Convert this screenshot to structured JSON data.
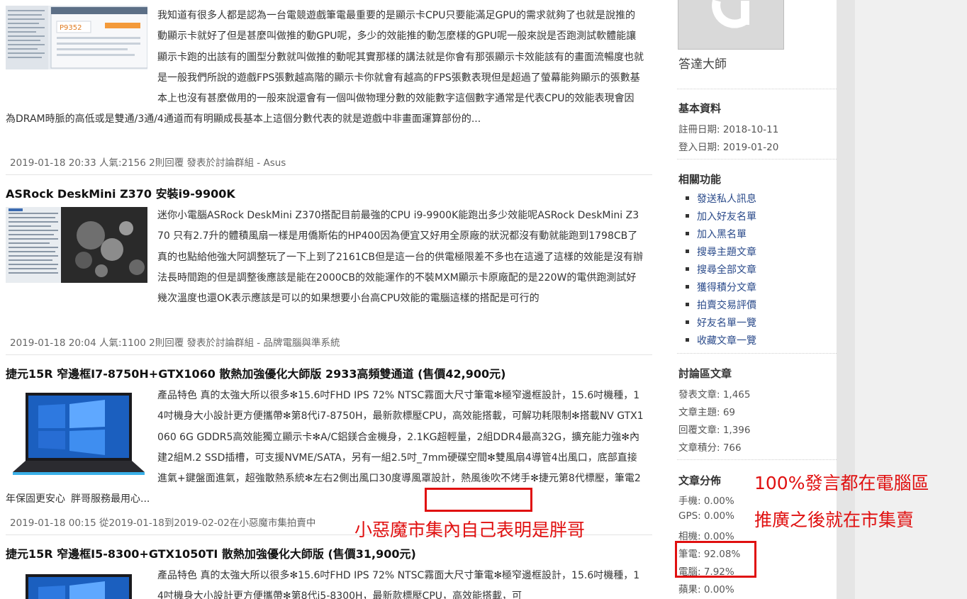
{
  "posts": [
    {
      "title": "",
      "excerpt": "我知道有很多人都是認為一台電競遊戲筆電最重要的是顯示卡CPU只要能滿足GPU的需求就夠了也就是說推的動顯示卡就好了但是甚麼叫做推的動GPU呢，多少的效能推的動怎麼樣的GPU呢一般來說是否跑測試軟體能讓顯示卡跑的出該有的圖型分數就叫做推的動呢其實那樣的講法就是你會有那張顯示卡效能該有的畫面流暢度也就是一般我們所說的遊戲FPS張數越高階的顯示卡你就會有越高的FPS張數表現但是超過了螢幕能夠顯示的張數基本上也沒有甚麼做用的一般來說還會有一個叫做物理分數的效能數字這個數字通常是代表CPU的效能表現會因為DRAM時脈的高低或是雙通/3通/4通道而有明顯成長基本上這個分數代表的就是遊戲中非畫面運算部份的...",
      "meta": "2019-01-18 20:33   人氣:2156   2則回覆   發表於討論群組 - Asus",
      "thumb_text": "P9352"
    },
    {
      "title": "ASRock DeskMini Z370 安裝i9-9900K",
      "excerpt": "迷你小電腦ASRock DeskMini Z370搭配目前最強的CPU i9-9900K能跑出多少效能呢ASRock DeskMini Z370 只有2.7升的體積風扇一樣是用僑斯佑的HP400因為便宜又好用全原廠的狀況都沒有動就能跑到1798CB了真的也點給他強大阿調整玩了一下上到了2161CB但是這一台的供電極限差不多也在這邊了這樣的效能是沒有辦法長時間跑的但是調整後應該是能在2000CB的效能運作的不裝MXM顯示卡原廠配的是220W的電供跑測試好幾次溫度也還OK表示應該是可以的如果想要小台高CPU效能的電腦這樣的搭配是可行的",
      "meta": "2019-01-18 20:04   人氣:1100   2則回覆   發表於討論群組 - 品牌電腦與準系統"
    },
    {
      "title": "捷元15R 窄邊框I7-8750H+GTX1060 散熱加強優化大師版 2933高頻雙通道 (售價42,900元)",
      "excerpt": "產品特色 真的太強大所以很多✻15.6吋FHD IPS 72% NTSC霧面大尺寸筆電✻極窄邊框設計，15.6吋機種，14吋機身大小設計更方便攜帶✻第8代i7-8750H，最新款標壓CPU，高效能搭載，可解功耗限制✻搭載NV GTX1060 6G GDDR5高效能獨立顯示卡✻A/C鋁鎂合金機身，2.1KG超輕量，2組DDR4最高32G，擴充能力強✻內建2組M.2 SSD插槽，可支援NVME/SATA，另有一組2.5吋_7mm硬碟空間✻雙風扇4導管4出風口，底部直接進氣+鍵盤面進氣，超強散熱系統✻左右2側出風口30度導風罩設計，熱風後吹不烤手✻捷元第8代標壓，筆電2年保固更安心",
      "excerpt_tail": "胖哥服務最用心...",
      "meta": "2019-01-18 00:15      從2019-01-18到2019-02-02在小惡魔市集拍賣中"
    },
    {
      "title": "捷元15R 窄邊框I5-8300+GTX1050TI 散熱加強優化大師版 (售價31,900元)",
      "excerpt": "產品特色 真的太強大所以很多✻15.6吋FHD IPS 72% NTSC霧面大尺寸筆電✻極窄邊框設計，15.6吋機種，14吋機身大小設計更方便攜帶✻第8代i5-8300H，最新款標壓CPU，高效能搭載，可"
    }
  ],
  "sidebar": {
    "username": "答達大師",
    "basic": {
      "title": "基本資料",
      "register": "註冊日期: 2018-10-11",
      "login": "登入日期: 2019-01-20"
    },
    "functions": {
      "title": "相關功能",
      "items": [
        "發送私人訊息",
        "加入好友名單",
        "加入黑名單",
        "搜尋主題文章",
        "搜尋全部文章",
        "獲得積分文章",
        "拍賣交易評價",
        "好友名單一覽",
        "收藏文章一覽"
      ]
    },
    "forum": {
      "title": "討論區文章",
      "posts": "發表文章: 1,465",
      "topics": "文章主題: 69",
      "replies": "回覆文章: 1,396",
      "points": "文章積分: 766"
    },
    "distribution": {
      "title": "文章分佈",
      "items": [
        "手機: 0.00%",
        "GPS: 0.00%",
        "相機: 0.00%",
        "筆電: 92.08%",
        "電腦: 7.92%",
        "蘋果: 0.00%"
      ]
    }
  },
  "annotations": {
    "a1": "小惡魔市集內自己表明是胖哥",
    "a2": "100%發言都在電腦區",
    "a3": "推廣之後就在市集賣"
  },
  "colors": {
    "annotation": "#e01010",
    "link": "#2a4a8a"
  }
}
